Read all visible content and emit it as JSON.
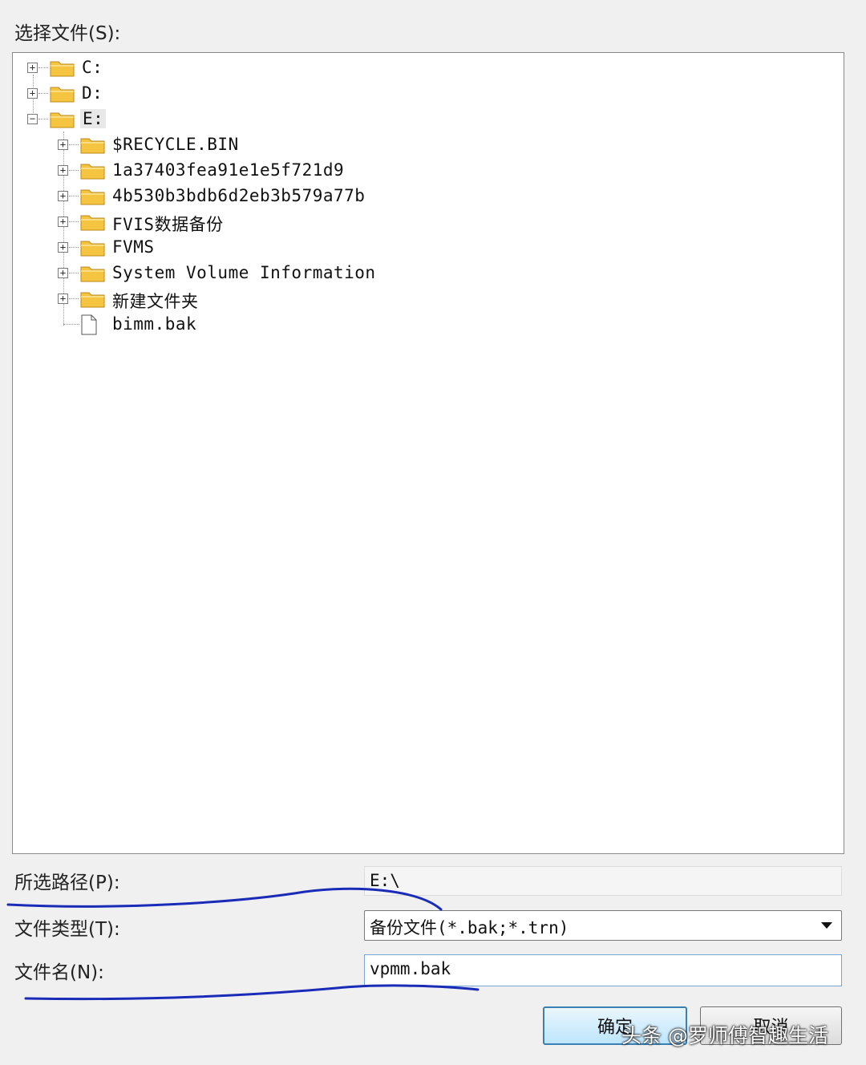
{
  "dialog": {
    "select_file_label": "选择文件(S):",
    "tree": [
      {
        "label": "C:",
        "type": "drive",
        "expander": "+"
      },
      {
        "label": "D:",
        "type": "drive",
        "expander": "+"
      },
      {
        "label": "E:",
        "type": "drive",
        "expander": "−"
      },
      {
        "label": "$RECYCLE.BIN",
        "type": "folder",
        "expander": "+"
      },
      {
        "label": "1a37403fea91e1e5f721d9",
        "type": "folder",
        "expander": "+"
      },
      {
        "label": "4b530b3bdb6d2eb3b579a77b",
        "type": "folder",
        "expander": "+"
      },
      {
        "label": "FVIS数据备份",
        "type": "folder",
        "expander": "+"
      },
      {
        "label": "FVMS",
        "type": "folder",
        "expander": "+"
      },
      {
        "label": "System Volume Information",
        "type": "folder",
        "expander": "+"
      },
      {
        "label": "新建文件夹",
        "type": "folder",
        "expander": "+"
      },
      {
        "label": "bimm.bak",
        "type": "file",
        "expander": ""
      }
    ],
    "selected_path_label": "所选路径(P):",
    "selected_path_value": "E:\\",
    "file_type_label": "文件类型(T):",
    "file_type_value": "备份文件(*.bak;*.trn)",
    "file_name_label": "文件名(N):",
    "file_name_value": "vpmm.bak",
    "ok_label": "确定",
    "cancel_label": "取消"
  },
  "watermark": "头条 @罗师傅智趣生活",
  "colors": {
    "folder": "#f5c542",
    "annotation_ink": "#1a2bb8",
    "ok_border": "#3c7fb1"
  }
}
